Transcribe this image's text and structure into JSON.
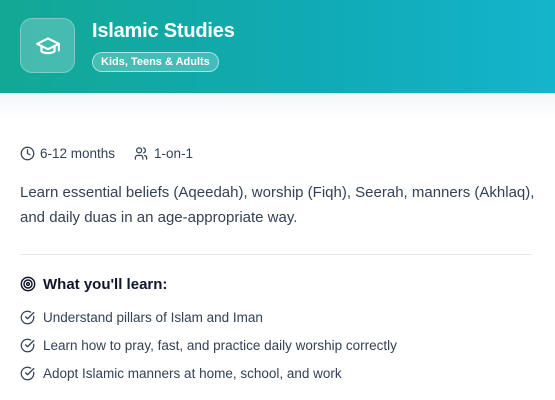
{
  "header": {
    "title": "Islamic Studies",
    "badge": "Kids, Teens & Adults",
    "icon": "graduation-cap-icon"
  },
  "meta": {
    "duration": "6-12 months",
    "format": "1-on-1"
  },
  "description": "Learn essential beliefs (Aqeedah), worship (Fiqh), Seerah, manners (Akhlaq), and daily duas in an age-appropriate way.",
  "learn": {
    "heading": "What you'll learn:",
    "items": [
      "Understand pillars of Islam and Iman",
      "Learn how to pray, fast, and practice daily worship correctly",
      "Adopt Islamic manners at home, school, and work"
    ]
  },
  "colors": {
    "header_start": "#13a894",
    "header_end": "#14b4cc",
    "text": "#334155"
  }
}
